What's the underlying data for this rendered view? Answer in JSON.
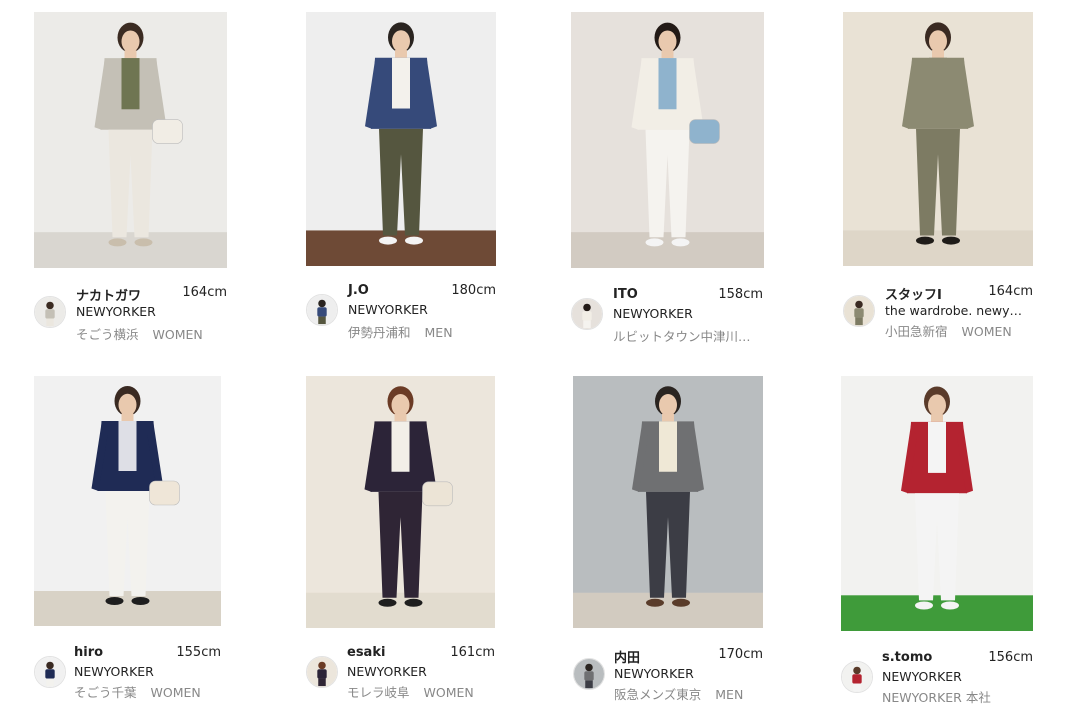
{
  "cards": [
    {
      "user": "ナカトガワ",
      "height": "164cm",
      "brand": "NEWYORKER",
      "store": "そごう横浜",
      "gender": "WOMEN",
      "colors": {
        "bg": "#ecebe8",
        "floor": "#d9d6d0",
        "top": "#c4c0b6",
        "inner": "#6f7552",
        "bottom": "#ebe7df",
        "hair": "#3b2b22",
        "shoe": "#c9beac",
        "bag": "#f1ede5"
      }
    },
    {
      "user": "J.O",
      "height": "180cm",
      "brand": "NEWYORKER",
      "store": "伊勢丹浦和",
      "gender": "MEN",
      "colors": {
        "bg": "#eeeeee",
        "floor": "#6e4a36",
        "top": "#364a7a",
        "inner": "#f3f1ec",
        "bottom": "#55563f",
        "hair": "#2a2420",
        "shoe": "#f4f4f4",
        "bag": ""
      }
    },
    {
      "user": "ITO",
      "height": "158cm",
      "brand": "NEWYORKER",
      "store": "ルビットタウン中津川…",
      "gender": "",
      "colors": {
        "bg": "#e6e1dc",
        "floor": "#d2cbc2",
        "top": "#f2eee6",
        "inner": "#8fb3cd",
        "bottom": "#f5f3ef",
        "hair": "#231a16",
        "shoe": "#f4f4f4",
        "bag": "#8fb3cd"
      }
    },
    {
      "user": "スタッフI",
      "height": "164cm",
      "brand": "the wardrobe. newy…",
      "store": "小田急新宿",
      "gender": "WOMEN",
      "colors": {
        "bg": "#e9e2d5",
        "floor": "#ded6c8",
        "top": "#8c8a72",
        "inner": "#8c8a72",
        "bottom": "#7d7b63",
        "hair": "#3a2a22",
        "shoe": "#1f1c19",
        "bag": ""
      }
    },
    {
      "user": "hiro",
      "height": "155cm",
      "brand": "NEWYORKER",
      "store": "そごう千葉",
      "gender": "WOMEN",
      "colors": {
        "bg": "#f1f1f1",
        "floor": "#d8d2c6",
        "top": "#1f2b55",
        "inner": "#dedfe6",
        "bottom": "#f3f2ee",
        "hair": "#3a2a22",
        "shoe": "#1e1e1e",
        "bag": "#efe6d8"
      }
    },
    {
      "user": "esaki",
      "height": "161cm",
      "brand": "NEWYORKER",
      "store": "モレラ岐阜",
      "gender": "WOMEN",
      "colors": {
        "bg": "#ece6dc",
        "floor": "#e2dccf",
        "top": "#2c2438",
        "inner": "#f2efe8",
        "bottom": "#2f2535",
        "hair": "#6b3b25",
        "shoe": "#1e1e1e",
        "bag": "#ece4d6"
      }
    },
    {
      "user": "内田",
      "height": "170cm",
      "brand": "NEWYORKER",
      "store": "阪急メンズ東京",
      "gender": "MEN",
      "colors": {
        "bg": "#b9bdbf",
        "floor": "#d2cbc0",
        "top": "#6f7072",
        "inner": "#efe8d6",
        "bottom": "#3c3d45",
        "hair": "#2a2420",
        "shoe": "#5a3c2a",
        "bag": ""
      }
    },
    {
      "user": "s.tomo",
      "height": "156cm",
      "brand": "NEWYORKER",
      "store": "NEWYORKER 本社",
      "gender": "",
      "colors": {
        "bg": "#f2f2f0",
        "floor": "#3f9b3a",
        "top": "#b42330",
        "inner": "#f4f4f4",
        "bottom": "#f4f4f4",
        "hair": "#5a3b2a",
        "shoe": "#f4f4f4",
        "bag": ""
      }
    }
  ]
}
